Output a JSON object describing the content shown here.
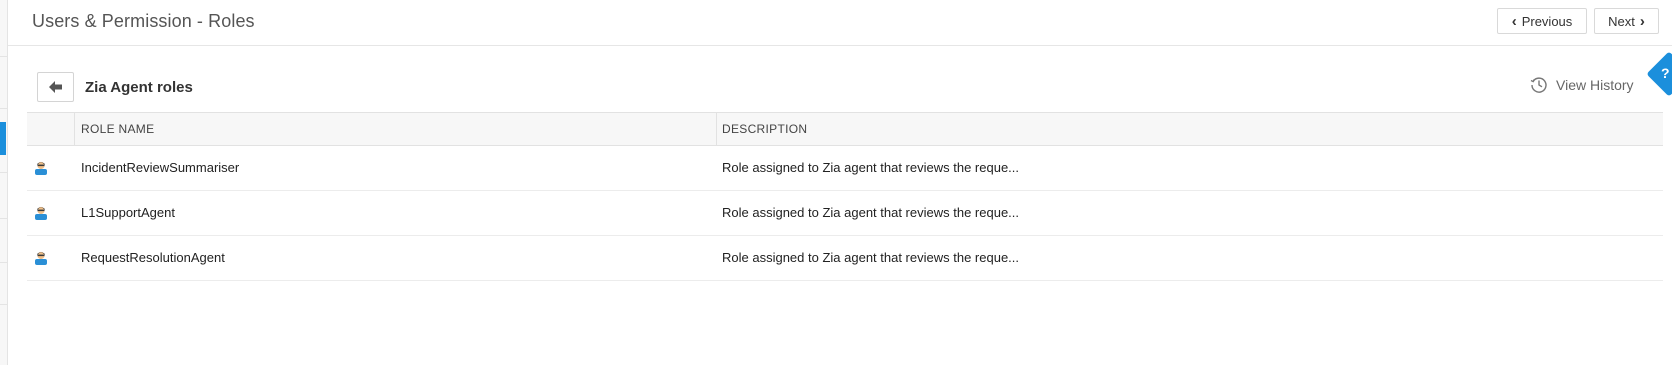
{
  "header": {
    "title": "Users & Permission - Roles",
    "prev_label": "Previous",
    "next_label": "Next"
  },
  "help": {
    "label": "?"
  },
  "section": {
    "title": "Zia Agent roles",
    "view_history_label": "View History"
  },
  "table": {
    "columns": [
      "ROLE NAME",
      "DESCRIPTION"
    ],
    "rows": [
      {
        "name": "IncidentReviewSummariser",
        "description": "Role assigned to Zia agent that reviews the reque..."
      },
      {
        "name": "L1SupportAgent",
        "description": "Role assigned to Zia agent that reviews the reque..."
      },
      {
        "name": "RequestResolutionAgent",
        "description": "Role assigned to Zia agent that reviews the reque..."
      }
    ]
  },
  "icons": {
    "back": "arrow-left-icon",
    "history": "history-clock-icon",
    "role": "agent-user-icon",
    "prev": "chevron-left-icon",
    "next": "chevron-right-icon"
  },
  "colors": {
    "accent": "#1b8fdc",
    "header_bg": "#f7f7f7",
    "title_text": "#555555"
  }
}
